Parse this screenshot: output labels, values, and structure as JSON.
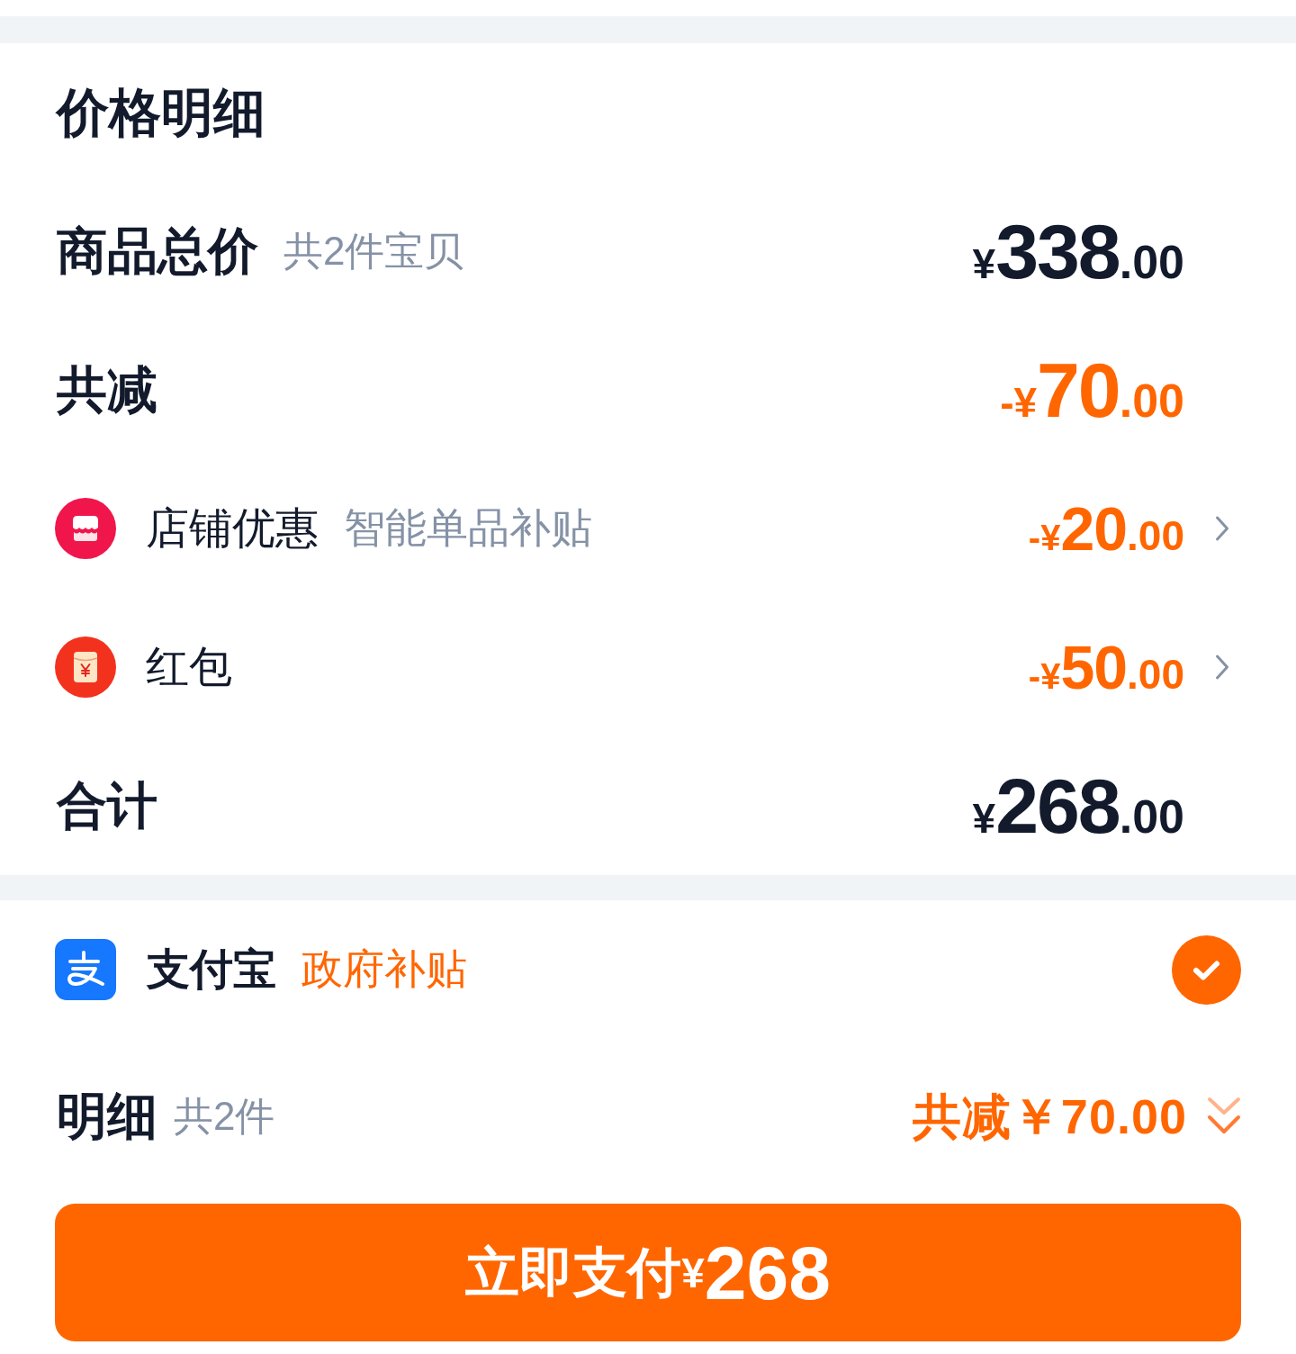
{
  "price_detail": {
    "title": "价格明细",
    "rows": [
      {
        "kind": "sum",
        "label": "商品总价",
        "note": "共2件宝贝",
        "amount": "¥338.00"
      },
      {
        "kind": "reduction",
        "label": "共减",
        "amount": "-¥70.00"
      },
      {
        "kind": "store",
        "label": "店铺优惠",
        "note": "智能单品补贴",
        "amount": "-¥20.00"
      },
      {
        "kind": "packet",
        "label": "红包",
        "amount": "-¥50.00"
      },
      {
        "kind": "sum",
        "label": "合计",
        "amount": "¥268.00"
      }
    ]
  },
  "payment": {
    "name": "支付宝",
    "tag": "政府补贴",
    "selected": true
  },
  "detail": {
    "label": "明细",
    "count": "共2件",
    "summary": "共减￥70.00",
    "expanded": false
  },
  "pay_button": {
    "label": "立即支付¥268"
  }
}
